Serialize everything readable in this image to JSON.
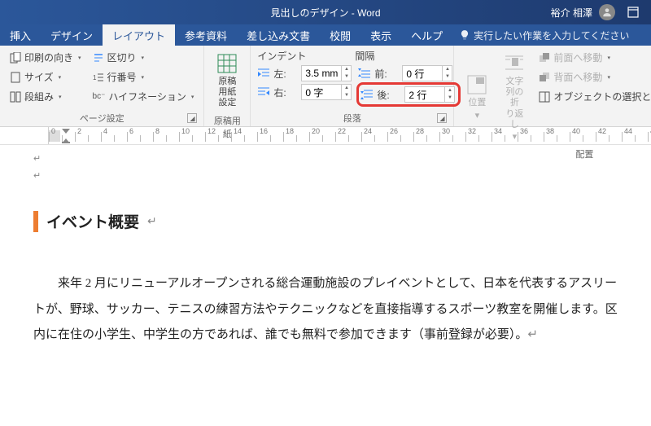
{
  "title": "見出しのデザイン - Word",
  "user": "裕介 相澤",
  "tabs": {
    "insert": "挿入",
    "design": "デザイン",
    "layout": "レイアウト",
    "references": "参考資料",
    "mailings": "差し込み文書",
    "review": "校閲",
    "view": "表示",
    "help": "ヘルプ",
    "tellme": "実行したい作業を入力してください"
  },
  "ribbon": {
    "page_setup": {
      "orientation": "印刷の向き",
      "size": "サイズ",
      "columns": "段組み",
      "breaks": "区切り",
      "line_numbers": "行番号",
      "hyphenation": "ハイフネーション",
      "label": "ページ設定"
    },
    "manuscript": {
      "button": "原稿用紙\n設定",
      "label": "原稿用紙"
    },
    "indent_header": "インデント",
    "spacing_header": "間隔",
    "indent": {
      "left_label": "左:",
      "left_value": "3.5 mm",
      "right_label": "右:",
      "right_value": "0 字"
    },
    "spacing": {
      "before_label": "前:",
      "before_value": "0 行",
      "after_label": "後:",
      "after_value": "2 行"
    },
    "paragraph_label": "段落",
    "arrange": {
      "position": "位置",
      "wrap": "文字列の折\nり返し",
      "bring_forward": "前面へ移動",
      "send_backward": "背面へ移動",
      "selection_pane": "オブジェクトの選択と表示",
      "label": "配置"
    }
  },
  "document": {
    "heading": "イベント概要",
    "body": "　来年 2 月にリニューアルオープンされる総合運動施設のプレイベントとして、日本を代表するアスリートが、野球、サッカー、テニスの練習方法やテクニックなどを直接指導するスポーツ教室を開催します。区内に在住の小学生、中学生の方であれば、誰でも無料で参加できます（事前登録が必要）。"
  }
}
